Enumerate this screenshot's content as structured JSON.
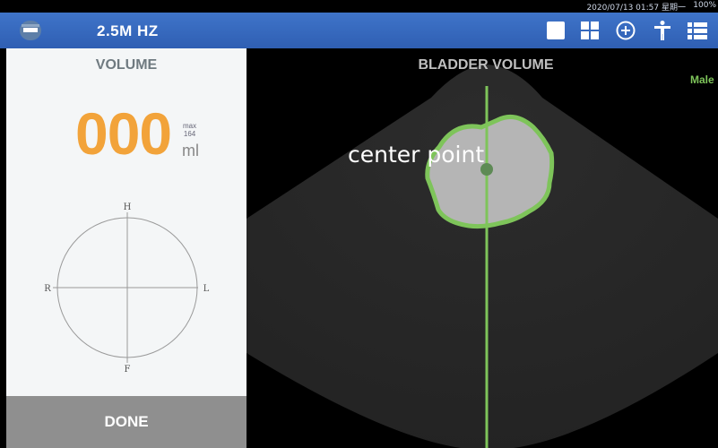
{
  "status": {
    "datetime": "2020/07/13 01:57 星期一",
    "battery": "100%"
  },
  "header": {
    "frequency": "2.5M HZ"
  },
  "toolbar": {
    "icons": [
      "single-view-icon",
      "quad-view-icon",
      "add-circle-icon",
      "body-marker-icon",
      "menu-list-icon"
    ]
  },
  "volume_panel": {
    "title": "VOLUME",
    "value": "000",
    "max_label": "max",
    "max_value": "164",
    "unit": "ml",
    "orientation": {
      "top": "H",
      "bottom": "F",
      "left": "R",
      "right": "L"
    },
    "done_label": "DONE"
  },
  "scan": {
    "title": "BLADDER VOLUME",
    "gender": "Male",
    "center_label": "center point"
  },
  "colors": {
    "accent_orange": "#f2a33a",
    "outline_green": "#7ec45a",
    "topbar_blue": "#3565b8"
  }
}
